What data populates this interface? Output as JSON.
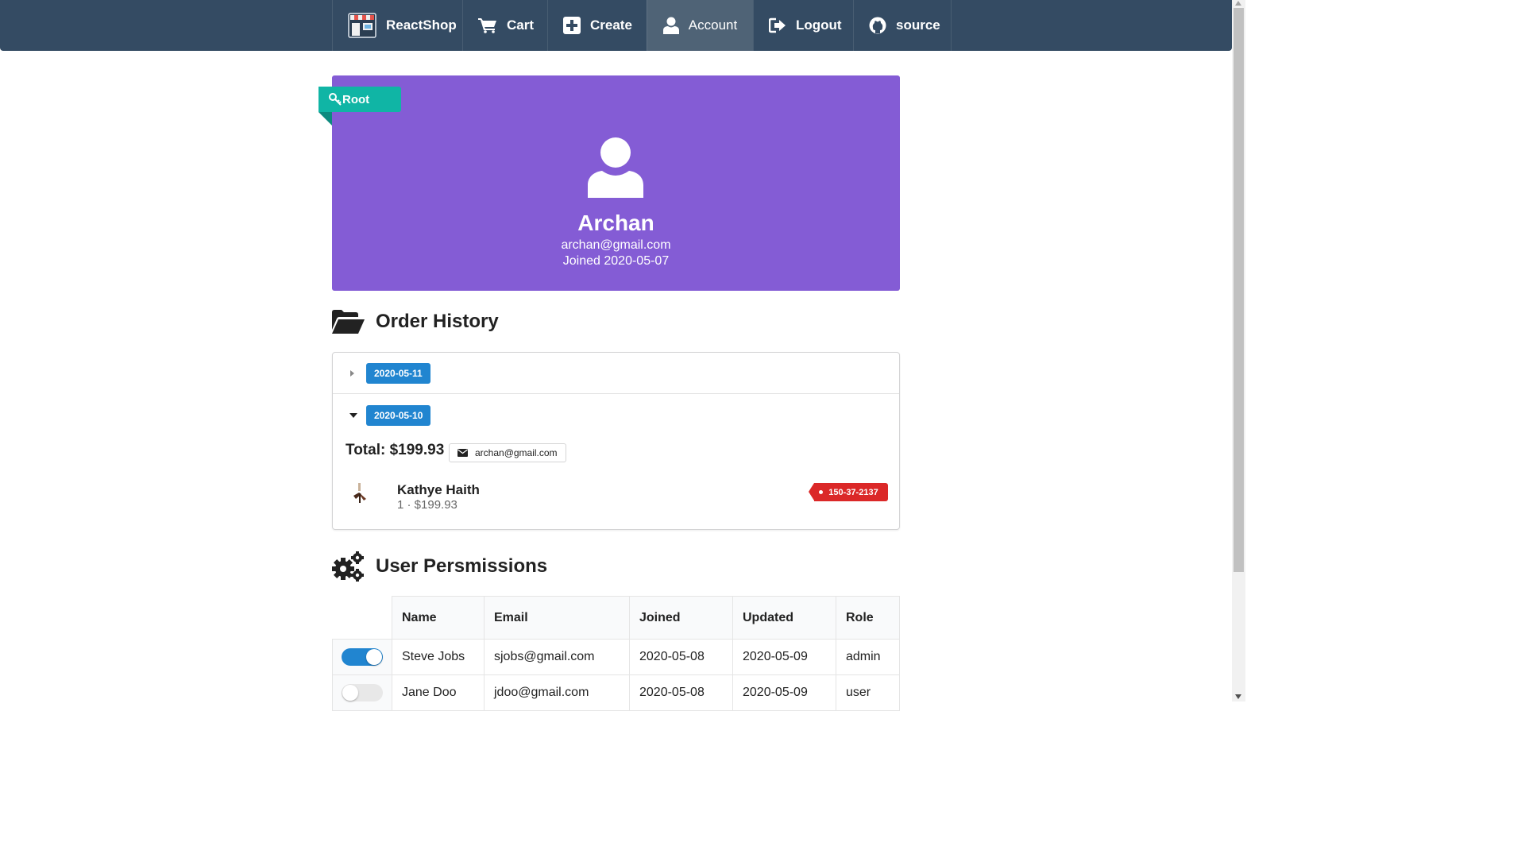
{
  "nav": {
    "items": [
      {
        "label": "ReactShop",
        "icon": "shop-logo-icon"
      },
      {
        "label": "Cart",
        "icon": "cart-icon"
      },
      {
        "label": "Create",
        "icon": "plus-square-icon"
      },
      {
        "label": "Account",
        "icon": "user-icon",
        "active": true
      },
      {
        "label": "Logout",
        "icon": "sign-out-icon"
      },
      {
        "label": "source",
        "icon": "github-icon"
      }
    ]
  },
  "profile": {
    "badge": "Root",
    "badge_icon": "key-icon",
    "name": "Archan",
    "email": "archan@gmail.com",
    "joined": "Joined 2020-05-07",
    "background_color": "#845cd5",
    "badge_color": "#10b5a5"
  },
  "order_history": {
    "title": "Order History",
    "orders": [
      {
        "date": "2020-05-11",
        "expanded": false
      },
      {
        "date": "2020-05-10",
        "expanded": true,
        "total": "Total: $199.93",
        "email": "archan@gmail.com",
        "items": [
          {
            "name": "Kathye Haith",
            "meta": "1 · $199.93",
            "tag": "150-37-2137"
          }
        ]
      }
    ]
  },
  "permissions": {
    "title": "User Persmissions",
    "columns": [
      "Name",
      "Email",
      "Joined",
      "Updated",
      "Role"
    ],
    "rows": [
      {
        "toggle": true,
        "name": "Steve Jobs",
        "email": "sjobs@gmail.com",
        "joined": "2020-05-08",
        "updated": "2020-05-09",
        "role": "admin"
      },
      {
        "toggle": false,
        "name": "Jane Doo",
        "email": "jdoo@gmail.com",
        "joined": "2020-05-08",
        "updated": "2020-05-09",
        "role": "user"
      }
    ]
  },
  "colors": {
    "navbar": "#344b63",
    "label_blue": "#2185d0",
    "tag_red": "#db2828"
  }
}
